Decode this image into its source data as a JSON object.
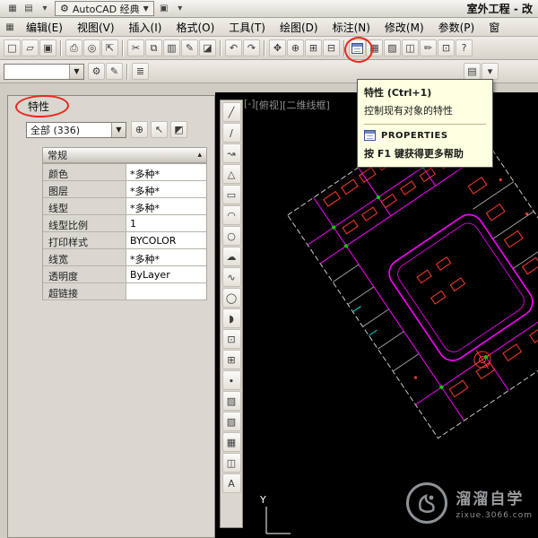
{
  "colors": {
    "annotation_red": "#e8281e",
    "road_magenta": "#ff00ff",
    "building_red": "#ff3b30",
    "dot_green": "#00cc00",
    "tooltip_bg": "#ffffe1"
  },
  "title_bar": {
    "workspace_label": "AutoCAD 经典",
    "workspace_icon": "⚙",
    "doc_title": "室外工程 - 改",
    "left_icons": [
      {
        "name": "app-grid-icon",
        "glyph": "▦"
      },
      {
        "name": "quick-new-icon",
        "glyph": "▤"
      },
      {
        "name": "quick-access-dropdown-icon",
        "glyph": "▾"
      }
    ],
    "after_icons": [
      {
        "name": "workspace-save-icon",
        "glyph": "▣"
      },
      {
        "name": "workspace-menu-icon",
        "glyph": "▾"
      }
    ]
  },
  "menu_bar": {
    "app_icon": "▦",
    "items": [
      {
        "name": "menu-edit",
        "label": "编辑(E)"
      },
      {
        "name": "menu-view",
        "label": "视图(V)"
      },
      {
        "name": "menu-insert",
        "label": "插入(I)"
      },
      {
        "name": "menu-format",
        "label": "格式(O)"
      },
      {
        "name": "menu-tools",
        "label": "工具(T)"
      },
      {
        "name": "menu-draw",
        "label": "绘图(D)"
      },
      {
        "name": "menu-dimension",
        "label": "标注(N)"
      },
      {
        "name": "menu-modify",
        "label": "修改(M)"
      },
      {
        "name": "menu-parametric",
        "label": "参数(P)"
      },
      {
        "name": "menu-window",
        "label": "窗"
      }
    ]
  },
  "toolbar_standard": {
    "group_file": [
      {
        "name": "new-file-icon",
        "glyph": "□"
      },
      {
        "name": "open-file-icon",
        "glyph": "▱"
      },
      {
        "name": "save-icon",
        "glyph": "▣"
      }
    ],
    "group_plot": [
      {
        "name": "plot-icon",
        "glyph": "⎙"
      },
      {
        "name": "plot-preview-icon",
        "glyph": "◎"
      },
      {
        "name": "publish-icon",
        "glyph": "⇱"
      }
    ],
    "group_clipboard": [
      {
        "name": "cut-icon",
        "glyph": "✂"
      },
      {
        "name": "copy-icon",
        "glyph": "⧉"
      },
      {
        "name": "paste-icon",
        "glyph": "▥"
      },
      {
        "name": "match-properties-icon",
        "glyph": "✎"
      },
      {
        "name": "block-editor-icon",
        "glyph": "◪"
      }
    ],
    "group_undo": [
      {
        "name": "undo-icon",
        "glyph": "↶"
      },
      {
        "name": "redo-icon",
        "glyph": "↷"
      }
    ],
    "group_zoom": [
      {
        "name": "pan-icon",
        "glyph": "✥"
      },
      {
        "name": "zoom-realtime-icon",
        "glyph": "⊕"
      },
      {
        "name": "zoom-window-icon",
        "glyph": "⊞"
      },
      {
        "name": "zoom-previous-icon",
        "glyph": "⊟"
      }
    ],
    "group_palettes": [
      {
        "name": "designcenter-icon",
        "glyph": "▦"
      },
      {
        "name": "tool-palettes-icon",
        "glyph": "▨"
      },
      {
        "name": "sheet-set-manager-icon",
        "glyph": "◫"
      },
      {
        "name": "markup-set-manager-icon",
        "glyph": "✏"
      },
      {
        "name": "quickcalc-icon",
        "glyph": "⊡"
      },
      {
        "name": "help-icon",
        "glyph": "?"
      }
    ]
  },
  "toolbar_secondary": {
    "combo_value": "",
    "left_buttons": [
      {
        "name": "layer-properties-icon",
        "glyph": "⚙"
      },
      {
        "name": "layer-states-icon",
        "glyph": "✎"
      }
    ],
    "mid_buttons": [
      {
        "name": "layer-list-icon",
        "glyph": "≣"
      }
    ],
    "right_buttons": [
      {
        "name": "draw-order-icon",
        "glyph": "▤"
      },
      {
        "name": "annotation-scale-icon",
        "glyph": "▾"
      }
    ]
  },
  "tooltip": {
    "title": "特性 (Ctrl+1)",
    "description": "控制现有对象的特性",
    "command": "PROPERTIES",
    "help": "按 F1 键获得更多帮助"
  },
  "properties_panel": {
    "title": "特性",
    "selection_combo": "全部 (336)",
    "combo_buttons": [
      {
        "name": "toggle-pickadd-icon",
        "glyph": "⊕"
      },
      {
        "name": "select-objects-icon",
        "glyph": "↖"
      },
      {
        "name": "quick-select-icon",
        "glyph": "◩"
      }
    ],
    "section_label": "常规",
    "section_collapse_icon": "▴",
    "rows": [
      {
        "label": "颜色",
        "value": "*多种*"
      },
      {
        "label": "图层",
        "value": "*多种*"
      },
      {
        "label": "线型",
        "value": "*多种*"
      },
      {
        "label": "线型比例",
        "value": "1"
      },
      {
        "label": "打印样式",
        "value": "BYCOLOR"
      },
      {
        "label": "线宽",
        "value": "*多种*"
      },
      {
        "label": "透明度",
        "value": "ByLayer"
      },
      {
        "label": "超链接",
        "value": ""
      }
    ]
  },
  "viewport": {
    "controls": [
      {
        "name": "viewport-menu-control",
        "label": "[-]"
      },
      {
        "name": "viewport-view-control",
        "label": "[俯视]"
      },
      {
        "name": "viewport-visual-style-control",
        "label": "[二维线框]"
      }
    ],
    "ucs_y_label": "Y"
  },
  "draw_toolbar": {
    "items": [
      {
        "name": "line-icon",
        "glyph": "╱"
      },
      {
        "name": "construction-line-icon",
        "glyph": "∕"
      },
      {
        "name": "polyline-icon",
        "glyph": "↝"
      },
      {
        "name": "polygon-icon",
        "glyph": "△"
      },
      {
        "name": "rectangle-icon",
        "glyph": "▭"
      },
      {
        "name": "arc-icon",
        "glyph": "◠"
      },
      {
        "name": "circle-icon",
        "glyph": "○"
      },
      {
        "name": "revision-cloud-icon",
        "glyph": "☁"
      },
      {
        "name": "spline-icon",
        "glyph": "∿"
      },
      {
        "name": "ellipse-icon",
        "glyph": "◯"
      },
      {
        "name": "ellipse-arc-icon",
        "glyph": "◗"
      },
      {
        "name": "insert-block-icon",
        "glyph": "⊡"
      },
      {
        "name": "make-block-icon",
        "glyph": "⊞"
      },
      {
        "name": "point-icon",
        "glyph": "∙"
      },
      {
        "name": "hatch-icon",
        "glyph": "▨"
      },
      {
        "name": "gradient-icon",
        "glyph": "▧"
      },
      {
        "name": "region-icon",
        "glyph": "▦"
      },
      {
        "name": "table-icon",
        "glyph": "◫"
      },
      {
        "name": "multiline-text-icon",
        "glyph": "A"
      }
    ]
  },
  "watermark": {
    "name": "溜溜自学",
    "url": "zixue.3066.com"
  }
}
